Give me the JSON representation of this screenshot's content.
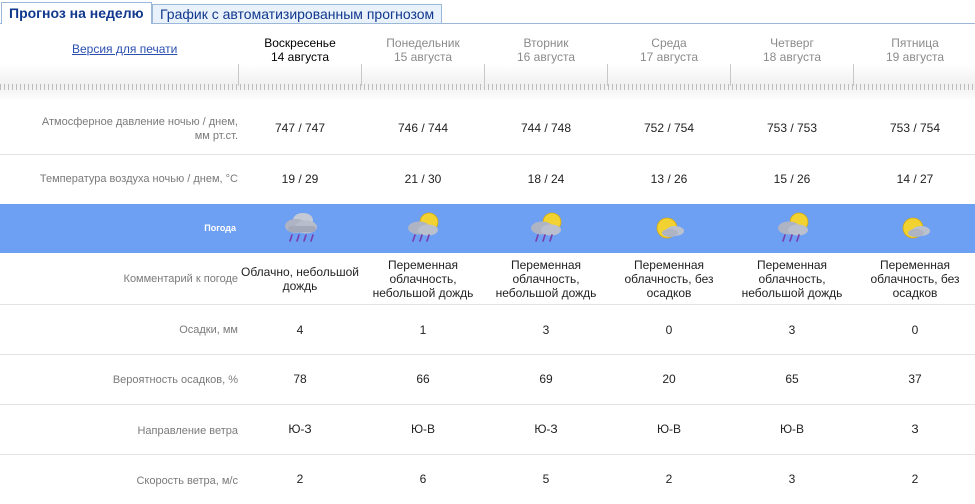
{
  "tabs": [
    {
      "label": "Прогноз на неделю",
      "active": true
    },
    {
      "label": "График с автоматизированным прогнозом",
      "active": false
    }
  ],
  "print_link": "Версия для печати",
  "days": [
    {
      "weekday": "Воскресенье",
      "date": "14 августа",
      "current": true
    },
    {
      "weekday": "Понедельник",
      "date": "15 августа",
      "current": false
    },
    {
      "weekday": "Вторник",
      "date": "16 августа",
      "current": false
    },
    {
      "weekday": "Среда",
      "date": "17 августа",
      "current": false
    },
    {
      "weekday": "Четверг",
      "date": "18 августа",
      "current": false
    },
    {
      "weekday": "Пятница",
      "date": "19 августа",
      "current": false
    }
  ],
  "rows": {
    "pressure": {
      "label_line1": "Атмосферное давление ночью  /  днем,",
      "label_line2": "мм рт.ст.",
      "values": [
        "747 / 747",
        "746 / 744",
        "744 / 748",
        "752 / 754",
        "753 / 753",
        "753 / 754"
      ]
    },
    "temperature": {
      "label": "Температура воздуха ночью  /  днем, °С",
      "values": [
        "19 / 29",
        "21 / 30",
        "18 / 24",
        "13 / 26",
        "15 / 26",
        "14 / 27"
      ]
    },
    "weather": {
      "label": "Погода",
      "icons": [
        "cloud-rain-icon",
        "sun-cloud-rain-icon",
        "sun-cloud-rain-icon",
        "sun-cloud-icon",
        "sun-cloud-rain-icon",
        "sun-cloud-icon"
      ]
    },
    "comment": {
      "label": "Комментарий к погоде",
      "values": [
        "Облачно, небольшой дождь",
        "Переменная облачность, небольшой дождь",
        "Переменная облачность, небольшой дождь",
        "Переменная облачность, без осадков",
        "Переменная облачность, небольшой дождь",
        "Переменная облачность, без осадков"
      ]
    },
    "precipitation": {
      "label": "Осадки, мм",
      "values": [
        "4",
        "1",
        "3",
        "0",
        "3",
        "0"
      ]
    },
    "probability": {
      "label": "Вероятность осадков, %",
      "values": [
        "78",
        "66",
        "69",
        "20",
        "65",
        "37"
      ]
    },
    "wind_dir": {
      "label": "Направление ветра",
      "values": [
        "Ю-З",
        "Ю-В",
        "Ю-З",
        "Ю-В",
        "Ю-В",
        "З"
      ]
    },
    "wind_speed": {
      "label": "Скорость ветра, м/с",
      "values": [
        "2",
        "6",
        "5",
        "2",
        "3",
        "2"
      ]
    }
  },
  "colors": {
    "weather_band": "#6d9ff3",
    "tab_text": "#10388e",
    "link": "#2b4fb0"
  }
}
